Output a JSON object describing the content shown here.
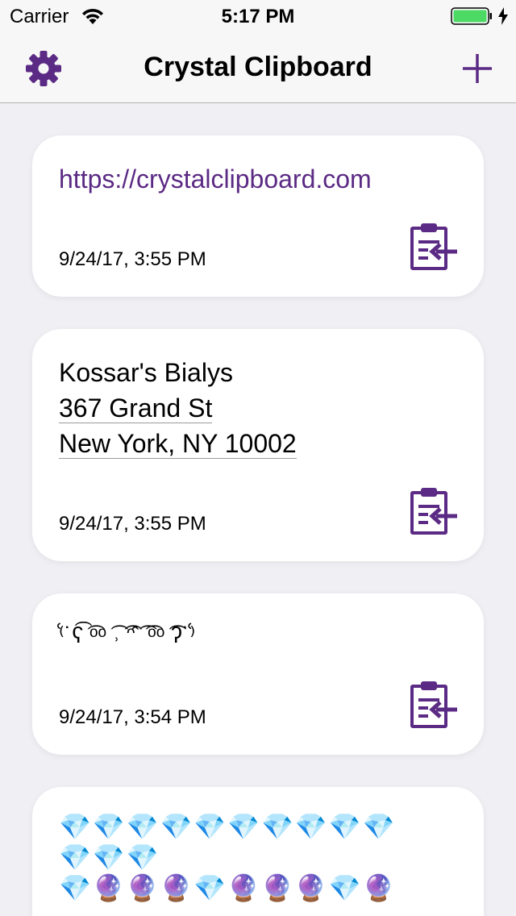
{
  "status_bar": {
    "carrier": "Carrier",
    "time": "5:17 PM",
    "battery_color": "#4cd964"
  },
  "nav": {
    "title": "Crystal Clipboard",
    "settings_icon": "gear-icon",
    "add_icon": "plus-icon",
    "accent_color": "#5b2a84"
  },
  "clips": [
    {
      "text": "https://crystalclipboard.com",
      "date": "9/24/17, 3:55 PM",
      "copy_icon": "clipboard-paste-icon"
    },
    {
      "name": "Kossar's Bialys",
      "address_line1": "367 Grand St",
      "address_line2": "New York, NY 10002",
      "date": "9/24/17, 3:55 PM",
      "copy_icon": "clipboard-paste-icon"
    },
    {
      "text": "⁽͑˙ʕ͡ ͡ᵒᵒ ͡˒ ͡ᵔ̂ ͡ ͡ᵒᵒ ͡ʔ˙⁾͑",
      "date": "9/24/17, 3:54 PM",
      "copy_icon": "clipboard-paste-icon"
    },
    {
      "row1": "💎💎💎💎💎💎💎💎💎💎",
      "row2": "💎💎💎",
      "row3": "💎🔮🔮🔮💎🔮🔮🔮💎🔮"
    }
  ]
}
